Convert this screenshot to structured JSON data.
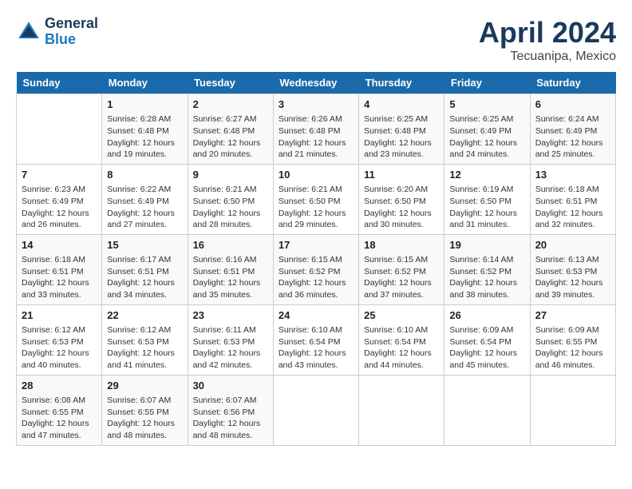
{
  "header": {
    "logo_line1": "General",
    "logo_line2": "Blue",
    "month": "April 2024",
    "location": "Tecuanipa, Mexico"
  },
  "days_of_week": [
    "Sunday",
    "Monday",
    "Tuesday",
    "Wednesday",
    "Thursday",
    "Friday",
    "Saturday"
  ],
  "weeks": [
    [
      {
        "day": "",
        "detail": ""
      },
      {
        "day": "1",
        "detail": "Sunrise: 6:28 AM\nSunset: 6:48 PM\nDaylight: 12 hours\nand 19 minutes."
      },
      {
        "day": "2",
        "detail": "Sunrise: 6:27 AM\nSunset: 6:48 PM\nDaylight: 12 hours\nand 20 minutes."
      },
      {
        "day": "3",
        "detail": "Sunrise: 6:26 AM\nSunset: 6:48 PM\nDaylight: 12 hours\nand 21 minutes."
      },
      {
        "day": "4",
        "detail": "Sunrise: 6:25 AM\nSunset: 6:48 PM\nDaylight: 12 hours\nand 23 minutes."
      },
      {
        "day": "5",
        "detail": "Sunrise: 6:25 AM\nSunset: 6:49 PM\nDaylight: 12 hours\nand 24 minutes."
      },
      {
        "day": "6",
        "detail": "Sunrise: 6:24 AM\nSunset: 6:49 PM\nDaylight: 12 hours\nand 25 minutes."
      }
    ],
    [
      {
        "day": "7",
        "detail": "Sunrise: 6:23 AM\nSunset: 6:49 PM\nDaylight: 12 hours\nand 26 minutes."
      },
      {
        "day": "8",
        "detail": "Sunrise: 6:22 AM\nSunset: 6:49 PM\nDaylight: 12 hours\nand 27 minutes."
      },
      {
        "day": "9",
        "detail": "Sunrise: 6:21 AM\nSunset: 6:50 PM\nDaylight: 12 hours\nand 28 minutes."
      },
      {
        "day": "10",
        "detail": "Sunrise: 6:21 AM\nSunset: 6:50 PM\nDaylight: 12 hours\nand 29 minutes."
      },
      {
        "day": "11",
        "detail": "Sunrise: 6:20 AM\nSunset: 6:50 PM\nDaylight: 12 hours\nand 30 minutes."
      },
      {
        "day": "12",
        "detail": "Sunrise: 6:19 AM\nSunset: 6:50 PM\nDaylight: 12 hours\nand 31 minutes."
      },
      {
        "day": "13",
        "detail": "Sunrise: 6:18 AM\nSunset: 6:51 PM\nDaylight: 12 hours\nand 32 minutes."
      }
    ],
    [
      {
        "day": "14",
        "detail": "Sunrise: 6:18 AM\nSunset: 6:51 PM\nDaylight: 12 hours\nand 33 minutes."
      },
      {
        "day": "15",
        "detail": "Sunrise: 6:17 AM\nSunset: 6:51 PM\nDaylight: 12 hours\nand 34 minutes."
      },
      {
        "day": "16",
        "detail": "Sunrise: 6:16 AM\nSunset: 6:51 PM\nDaylight: 12 hours\nand 35 minutes."
      },
      {
        "day": "17",
        "detail": "Sunrise: 6:15 AM\nSunset: 6:52 PM\nDaylight: 12 hours\nand 36 minutes."
      },
      {
        "day": "18",
        "detail": "Sunrise: 6:15 AM\nSunset: 6:52 PM\nDaylight: 12 hours\nand 37 minutes."
      },
      {
        "day": "19",
        "detail": "Sunrise: 6:14 AM\nSunset: 6:52 PM\nDaylight: 12 hours\nand 38 minutes."
      },
      {
        "day": "20",
        "detail": "Sunrise: 6:13 AM\nSunset: 6:53 PM\nDaylight: 12 hours\nand 39 minutes."
      }
    ],
    [
      {
        "day": "21",
        "detail": "Sunrise: 6:12 AM\nSunset: 6:53 PM\nDaylight: 12 hours\nand 40 minutes."
      },
      {
        "day": "22",
        "detail": "Sunrise: 6:12 AM\nSunset: 6:53 PM\nDaylight: 12 hours\nand 41 minutes."
      },
      {
        "day": "23",
        "detail": "Sunrise: 6:11 AM\nSunset: 6:53 PM\nDaylight: 12 hours\nand 42 minutes."
      },
      {
        "day": "24",
        "detail": "Sunrise: 6:10 AM\nSunset: 6:54 PM\nDaylight: 12 hours\nand 43 minutes."
      },
      {
        "day": "25",
        "detail": "Sunrise: 6:10 AM\nSunset: 6:54 PM\nDaylight: 12 hours\nand 44 minutes."
      },
      {
        "day": "26",
        "detail": "Sunrise: 6:09 AM\nSunset: 6:54 PM\nDaylight: 12 hours\nand 45 minutes."
      },
      {
        "day": "27",
        "detail": "Sunrise: 6:09 AM\nSunset: 6:55 PM\nDaylight: 12 hours\nand 46 minutes."
      }
    ],
    [
      {
        "day": "28",
        "detail": "Sunrise: 6:08 AM\nSunset: 6:55 PM\nDaylight: 12 hours\nand 47 minutes."
      },
      {
        "day": "29",
        "detail": "Sunrise: 6:07 AM\nSunset: 6:55 PM\nDaylight: 12 hours\nand 48 minutes."
      },
      {
        "day": "30",
        "detail": "Sunrise: 6:07 AM\nSunset: 6:56 PM\nDaylight: 12 hours\nand 48 minutes."
      },
      {
        "day": "",
        "detail": ""
      },
      {
        "day": "",
        "detail": ""
      },
      {
        "day": "",
        "detail": ""
      },
      {
        "day": "",
        "detail": ""
      }
    ]
  ]
}
